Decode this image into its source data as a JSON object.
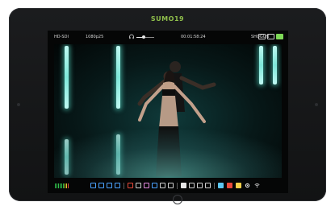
{
  "device": {
    "brand": "SUMO19"
  },
  "topbar": {
    "input": "HD-SDI",
    "format": "1080p25",
    "timecode": "00:01:58:24",
    "codec": "SHOGUN",
    "volume": 0.4
  },
  "toolbar": {
    "meter_colors": [
      "#2fbf4a",
      "#2fbf4a",
      "#2fbf4a",
      "#2fbf4a",
      "#2fbf4a",
      "#2fbf4a",
      "#e7d12a",
      "#e7d12a",
      "#e84a3a"
    ]
  },
  "colors": {
    "brand_green": "#8fbf4b",
    "accent_teal": "#7fe8da"
  }
}
